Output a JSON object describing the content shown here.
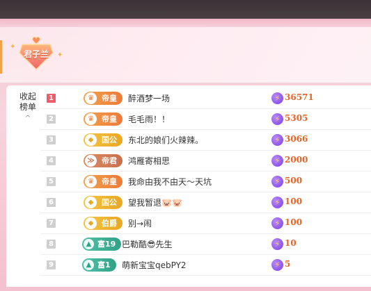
{
  "header": {
    "badge_text": "君子兰"
  },
  "collapse": {
    "label_line1": "收起",
    "label_line2": "榜单",
    "caret": "^"
  },
  "rows": [
    {
      "rank": "1",
      "level": "帝皇",
      "level_style": "orange",
      "level_icon": "crown-icon",
      "name": "醉酒梦一场",
      "score": "36571"
    },
    {
      "rank": "2",
      "level": "帝皇",
      "level_style": "orange",
      "level_icon": "crown-icon",
      "name": "毛毛雨！！",
      "score": "5305"
    },
    {
      "rank": "3",
      "level": "国公",
      "level_style": "gold",
      "level_icon": "diamond-icon",
      "name": "东北的娘们火辣辣。",
      "score": "3066"
    },
    {
      "rank": "4",
      "level": "帝君",
      "level_style": "brown",
      "level_icon": "chevron-icon",
      "name": "鸿雁寄相思",
      "score": "2000"
    },
    {
      "rank": "5",
      "level": "帝皇",
      "level_style": "orange",
      "level_icon": "crown-icon",
      "name": "我命由我不由天～天坑",
      "score": "500"
    },
    {
      "rank": "6",
      "level": "国公",
      "level_style": "gold",
      "level_icon": "diamond-icon",
      "name": "望我暂退🐷🐷",
      "score": "100"
    },
    {
      "rank": "7",
      "level": "伯爵",
      "level_style": "gold",
      "level_icon": "diamond-icon",
      "name": "别→闹",
      "score": "100"
    },
    {
      "rank": "8",
      "level": "富19",
      "level_style": "green",
      "level_icon": "triangle-icon",
      "name": "巴勒酷😎先生",
      "score": "10"
    },
    {
      "rank": "9",
      "level": "富1",
      "level_style": "green",
      "level_icon": "triangle-icon",
      "name": "萌新宝宝qebPY2",
      "score": "5"
    }
  ]
}
